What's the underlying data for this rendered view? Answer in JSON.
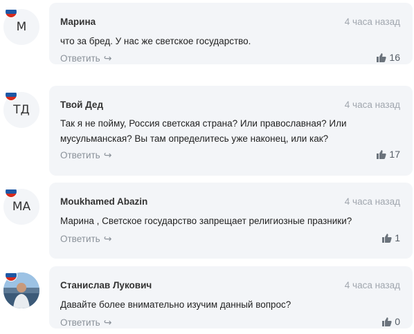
{
  "colors": {
    "card_bg": "#f3f5f8",
    "muted": "#a0a6ae",
    "text": "#222222",
    "flag": [
      "#ffffff",
      "#1c57a5",
      "#d52b1e"
    ]
  },
  "comments": [
    {
      "avatar_initials": "М",
      "author": "Марина",
      "time": "4 часа назад",
      "text": "что за бред. У нас же светское государство.",
      "reply_label": "Ответить",
      "likes": "16"
    },
    {
      "avatar_initials": "ТД",
      "author": "Твой Дед",
      "time": "4 часа назад",
      "text": "Так я не пойму, Россия светская страна? Или православная? Или мусульманская? Вы там определитесь уже наконец, или как?",
      "reply_label": "Ответить",
      "likes": "17"
    },
    {
      "avatar_initials": "МА",
      "author": "Moukhamed Abazin",
      "time": "4 часа назад",
      "text": "Марина , Светское государство запрещает религиозные празники?",
      "reply_label": "Ответить",
      "likes": "1"
    },
    {
      "avatar_initials": "",
      "author": "Станислав Лукович",
      "time": "4 часа назад",
      "text": "Давайте более внимательно изучим данный вопрос?",
      "reply_label": "Ответить",
      "likes": "0"
    }
  ]
}
